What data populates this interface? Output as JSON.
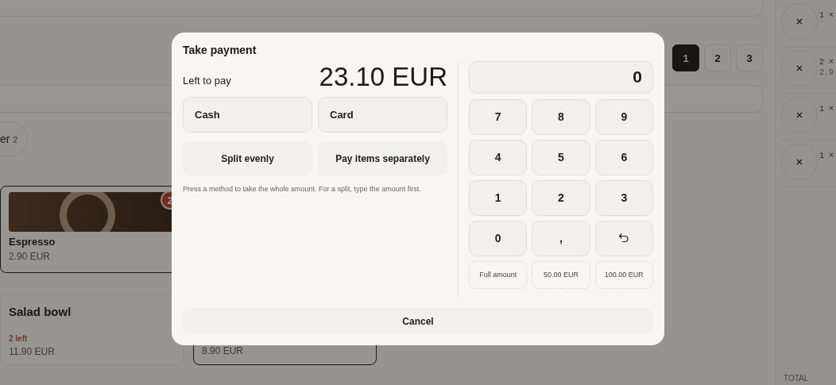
{
  "pages": [
    {
      "label": "1",
      "selected": true
    },
    {
      "label": "2",
      "selected": false
    },
    {
      "label": "3",
      "selected": false
    }
  ],
  "category_chip": {
    "label": "er",
    "count": "2"
  },
  "products": [
    {
      "name": "Espresso",
      "price": "2.90 EUR",
      "selected": true,
      "badge": "2",
      "photo": true
    },
    {
      "name": "Salad bowl",
      "stock": "2 left",
      "price": "11.90 EUR",
      "selected": false,
      "photo": false
    },
    {
      "price": "8.90 EUR",
      "selected": true,
      "photo": false
    }
  ],
  "order_lines": [
    {
      "qty": "1 ×"
    },
    {
      "qty": "2 ×",
      "price": "2.9"
    },
    {
      "qty": "1 ×"
    },
    {
      "qty": "1 ×"
    }
  ],
  "total_label": "TOTAL",
  "dialog": {
    "title": "Take payment",
    "left_label": "Left to pay",
    "amount": "23.10 EUR",
    "methods": [
      "Cash",
      "Card"
    ],
    "split_options": [
      "Split evenly",
      "Pay items separately"
    ],
    "hint": "Press a method to take the whole amount. For a split, type the amount first.",
    "display": "0",
    "keys": [
      {
        "kind": "digit",
        "label": "7"
      },
      {
        "kind": "digit",
        "label": "8"
      },
      {
        "kind": "digit",
        "label": "9"
      },
      {
        "kind": "digit",
        "label": "4"
      },
      {
        "kind": "digit",
        "label": "5"
      },
      {
        "kind": "digit",
        "label": "6"
      },
      {
        "kind": "digit",
        "label": "1"
      },
      {
        "kind": "digit",
        "label": "2"
      },
      {
        "kind": "digit",
        "label": "3"
      },
      {
        "kind": "digit",
        "label": "0"
      },
      {
        "kind": "digit",
        "label": ","
      },
      {
        "kind": "backspace"
      }
    ],
    "quick_amounts": [
      "Full amount",
      "50.00 EUR",
      "100.00 EUR"
    ],
    "cancel": "Cancel"
  }
}
